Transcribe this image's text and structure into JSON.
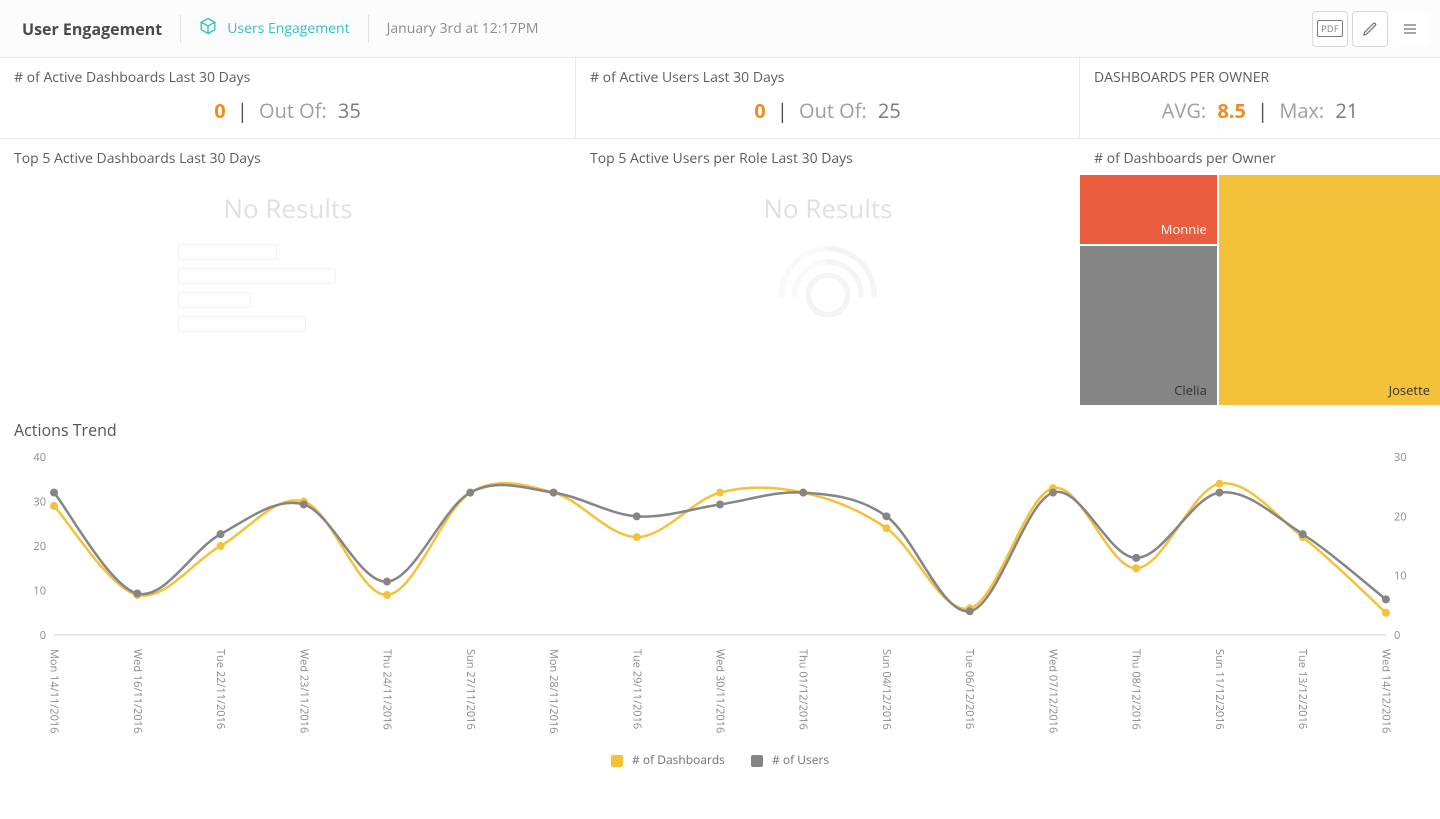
{
  "header": {
    "title": "User Engagement",
    "breadcrumb": "Users Engagement",
    "timestamp": "January 3rd at 12:17PM",
    "actions": {
      "pdf": "PDF"
    }
  },
  "kpis": {
    "active_dash": {
      "label": "# of Active Dashboards Last 30 Days",
      "value": "0",
      "outof_label": "Out Of:",
      "outof": "35"
    },
    "active_users": {
      "label": "# of Active Users Last 30 Days",
      "value": "0",
      "outof_label": "Out Of:",
      "outof": "25"
    },
    "per_owner": {
      "label": "DASHBOARDS PER OWNER",
      "avg_label": "AVG:",
      "avg": "8.5",
      "max_label": "Max:",
      "max": "21"
    }
  },
  "panels": {
    "top_dash": {
      "title": "Top 5 Active Dashboards Last 30 Days",
      "empty": "No Results"
    },
    "top_users": {
      "title": "Top 5 Active Users per Role Last 30 Days",
      "empty": "No Results"
    },
    "treemap": {
      "title": "# of Dashboards per Owner",
      "monnie": "Monnie",
      "clelia": "Clelia",
      "josette": "Josette"
    }
  },
  "trend": {
    "title": "Actions Trend",
    "legend": {
      "dash": "# of Dashboards",
      "users": "# of Users"
    }
  },
  "colors": {
    "dash": "#f4c23a",
    "users": "#858585",
    "accent": "#ef8b22",
    "orange": "#e85d3d"
  },
  "chart_data": {
    "type": "line",
    "title": "Actions Trend",
    "xlabel": "",
    "ylabel_left": "# of Dashboards",
    "ylabel_right": "# of Users",
    "ylim_left": [
      0,
      40
    ],
    "ylim_right": [
      0,
      30
    ],
    "categories": [
      "Mon 14/11/2016",
      "Wed 16/11/2016",
      "Tue 22/11/2016",
      "Wed 23/11/2016",
      "Thu 24/11/2016",
      "Sun 27/11/2016",
      "Mon 28/11/2016",
      "Tue 29/11/2016",
      "Wed 30/11/2016",
      "Thu 01/12/2016",
      "Sun 04/12/2016",
      "Tue 06/12/2016",
      "Wed 07/12/2016",
      "Thu 08/12/2016",
      "Sun 11/12/2016",
      "Tue 13/12/2016",
      "Wed 14/12/2016"
    ],
    "series": [
      {
        "name": "# of Dashboards",
        "axis": "left",
        "color": "#f4c23a",
        "values": [
          29,
          9,
          20,
          30,
          9,
          32,
          32,
          22,
          32,
          32,
          24,
          6,
          33,
          15,
          34,
          22,
          5
        ]
      },
      {
        "name": "# of Users",
        "axis": "right",
        "color": "#858585",
        "values": [
          24,
          7,
          17,
          22,
          9,
          24,
          24,
          20,
          22,
          24,
          20,
          4,
          24,
          13,
          24,
          17,
          6
        ]
      }
    ]
  }
}
